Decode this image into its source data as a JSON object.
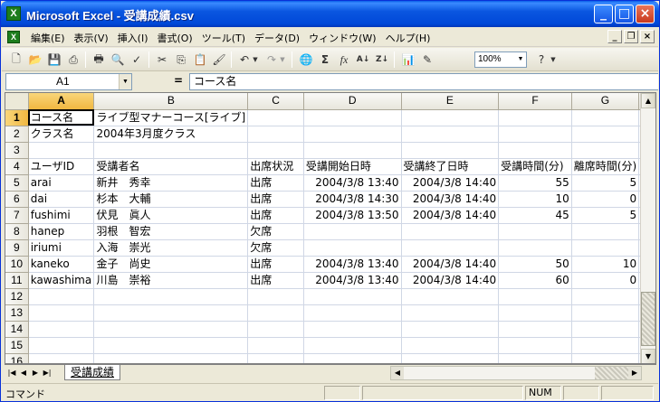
{
  "window": {
    "title": "Microsoft Excel - 受講成績.csv",
    "app_icon": "X"
  },
  "menu": [
    "編集(E)",
    "表示(V)",
    "挿入(I)",
    "書式(O)",
    "ツール(T)",
    "データ(D)",
    "ウィンドウ(W)",
    "ヘルプ(H)"
  ],
  "toolbar": {
    "zoom": "100%"
  },
  "formula_bar": {
    "cell_ref": "A1",
    "eq": "=",
    "value": "コース名"
  },
  "columns": [
    "A",
    "B",
    "C",
    "D",
    "E",
    "F",
    "G",
    ""
  ],
  "rows": [
    {
      "n": "1",
      "cells": [
        "コース名",
        "ライブ型マナーコース[ライブ]",
        "",
        "",
        "",
        "",
        "",
        ""
      ]
    },
    {
      "n": "2",
      "cells": [
        "クラス名",
        "2004年3月度クラス",
        "",
        "",
        "",
        "",
        "",
        ""
      ]
    },
    {
      "n": "3",
      "cells": [
        "",
        "",
        "",
        "",
        "",
        "",
        "",
        ""
      ]
    },
    {
      "n": "4",
      "cells": [
        "ユーザID",
        "受講者名",
        "出席状況",
        "受講開始日時",
        "受講終了日時",
        "受講時間(分)",
        "離席時間(分)",
        ""
      ]
    },
    {
      "n": "5",
      "cells": [
        "arai",
        "新井　秀幸",
        "出席",
        "2004/3/8 13:40",
        "2004/3/8 14:40",
        "55",
        "5",
        ""
      ]
    },
    {
      "n": "6",
      "cells": [
        "dai",
        "杉本　大輔",
        "出席",
        "2004/3/8 14:30",
        "2004/3/8 14:40",
        "10",
        "0",
        ""
      ]
    },
    {
      "n": "7",
      "cells": [
        "fushimi",
        "伏見　眞人",
        "出席",
        "2004/3/8 13:50",
        "2004/3/8 14:40",
        "45",
        "5",
        ""
      ]
    },
    {
      "n": "8",
      "cells": [
        "hanep",
        "羽根　智宏",
        "欠席",
        "",
        "",
        "",
        "",
        ""
      ]
    },
    {
      "n": "9",
      "cells": [
        "iriumi",
        "入海　崇光",
        "欠席",
        "",
        "",
        "",
        "",
        ""
      ]
    },
    {
      "n": "10",
      "cells": [
        "kaneko",
        "金子　尚史",
        "出席",
        "2004/3/8 13:40",
        "2004/3/8 14:40",
        "50",
        "10",
        ""
      ]
    },
    {
      "n": "11",
      "cells": [
        "kawashima",
        "川島　崇裕",
        "出席",
        "2004/3/8 13:40",
        "2004/3/8 14:40",
        "60",
        "0",
        ""
      ]
    },
    {
      "n": "12",
      "cells": [
        "",
        "",
        "",
        "",
        "",
        "",
        "",
        ""
      ]
    },
    {
      "n": "13",
      "cells": [
        "",
        "",
        "",
        "",
        "",
        "",
        "",
        ""
      ]
    },
    {
      "n": "14",
      "cells": [
        "",
        "",
        "",
        "",
        "",
        "",
        "",
        ""
      ]
    },
    {
      "n": "15",
      "cells": [
        "",
        "",
        "",
        "",
        "",
        "",
        "",
        ""
      ]
    },
    {
      "n": "16",
      "cells": [
        "",
        "",
        "",
        "",
        "",
        "",
        "",
        ""
      ]
    }
  ],
  "sheet_tab": "受講成績",
  "status": {
    "mode": "コマンド",
    "num": "NUM"
  }
}
